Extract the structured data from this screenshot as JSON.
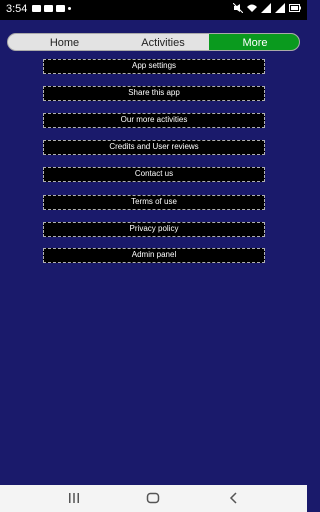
{
  "status_bar": {
    "time": "3:54"
  },
  "tabs": [
    {
      "label": "Home"
    },
    {
      "label": "Activities"
    },
    {
      "label": "More"
    }
  ],
  "menu": {
    "items": [
      {
        "label": "App settings"
      },
      {
        "label": "Share this app"
      },
      {
        "label": "Our more activities"
      },
      {
        "label": "Credits and User reviews"
      },
      {
        "label": "Contact us"
      },
      {
        "label": "Terms of use"
      },
      {
        "label": "Privacy policy"
      },
      {
        "label": "Admin panel"
      }
    ]
  },
  "colors": {
    "background": "#1a1a6b",
    "active_tab": "#0a9a1e",
    "menu_item_bg": "#000000"
  }
}
